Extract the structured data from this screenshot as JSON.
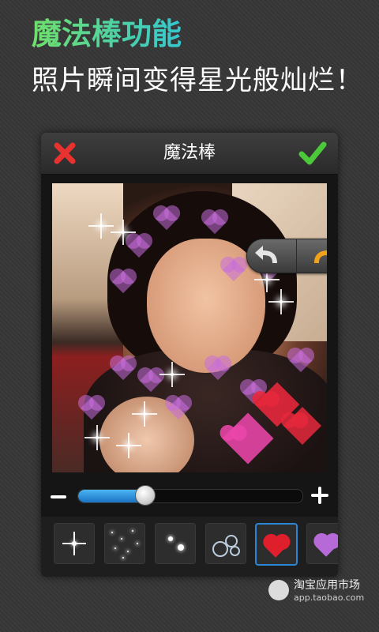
{
  "promo": {
    "headline": "魔法棒功能",
    "subheadline": "照片瞬间变得星光般灿烂！"
  },
  "titlebar": {
    "title": "魔法棒",
    "close_icon": "close-x-icon",
    "confirm_icon": "checkmark-icon"
  },
  "history": {
    "undo_icon": "undo-arrow-icon",
    "redo_icon": "redo-arrow-icon"
  },
  "brush_size": {
    "value": 0.3,
    "decrease_icon": "minus-icon",
    "increase_icon": "plus-icon"
  },
  "effects": {
    "items": [
      {
        "name": "single-sparkle",
        "selected": false
      },
      {
        "name": "star-dust",
        "selected": false
      },
      {
        "name": "double-sparkle",
        "selected": false
      },
      {
        "name": "bubbles",
        "selected": false
      },
      {
        "name": "red-heart",
        "selected": true
      },
      {
        "name": "purple-heart",
        "selected": false
      }
    ]
  },
  "watermark": {
    "store_name": "淘宝应用市场",
    "url": "app.taobao.com"
  },
  "colors": {
    "close": "#e8322f",
    "confirm": "#4cc93b",
    "redo": "#f2a21a",
    "slider_fill": "#2b86d8",
    "selected_border": "#2b86d8"
  }
}
